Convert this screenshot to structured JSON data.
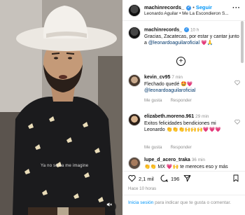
{
  "video": {
    "overlay_caption": "Ya no sé ca me imagine"
  },
  "header": {
    "username": "machinrecords_",
    "separator": "•",
    "follow_label": "Seguir",
    "audio_line": "Leonardo Aguilar • Me La Escondieron S..."
  },
  "caption": {
    "username": "machinrecords_",
    "time": "10 h",
    "text": "Gracias, Zacatecas, por estar y cantar junto a ",
    "mention": "@leonardoaguilaroficial",
    "emojis": "💗🙏"
  },
  "comments": [
    {
      "username": "kevin_cv95",
      "time": "7 min",
      "text": "Flechado quedé 🤩💗",
      "mention": "@leonardoaguilaroficial",
      "like_label": "Me gusta",
      "reply_label": "Responder"
    },
    {
      "username": "elizabeth.moreno.961",
      "time": "29 min",
      "text": "Exitos felicidades bendiciones mi Leonardo 👏👏👏🙌🙌🙌💗💗💗",
      "like_label": "Me gusta",
      "reply_label": "Responder"
    },
    {
      "username": "lupe_d_acero_traka",
      "time": "36 min",
      "text": "👏👏 MX 💗🙌 te mereces eso y más"
    }
  ],
  "actions": {
    "likes": "2,1 mil",
    "comments": "196"
  },
  "ago": "Hace 10 horas",
  "login": {
    "link": "Inicia sesión",
    "text": " para indicar que te gusta o comentar."
  },
  "colors": {
    "accent": "#0095f6",
    "mention": "#00376b",
    "muted": "#8e8e8e",
    "heart": "#ed4956"
  }
}
